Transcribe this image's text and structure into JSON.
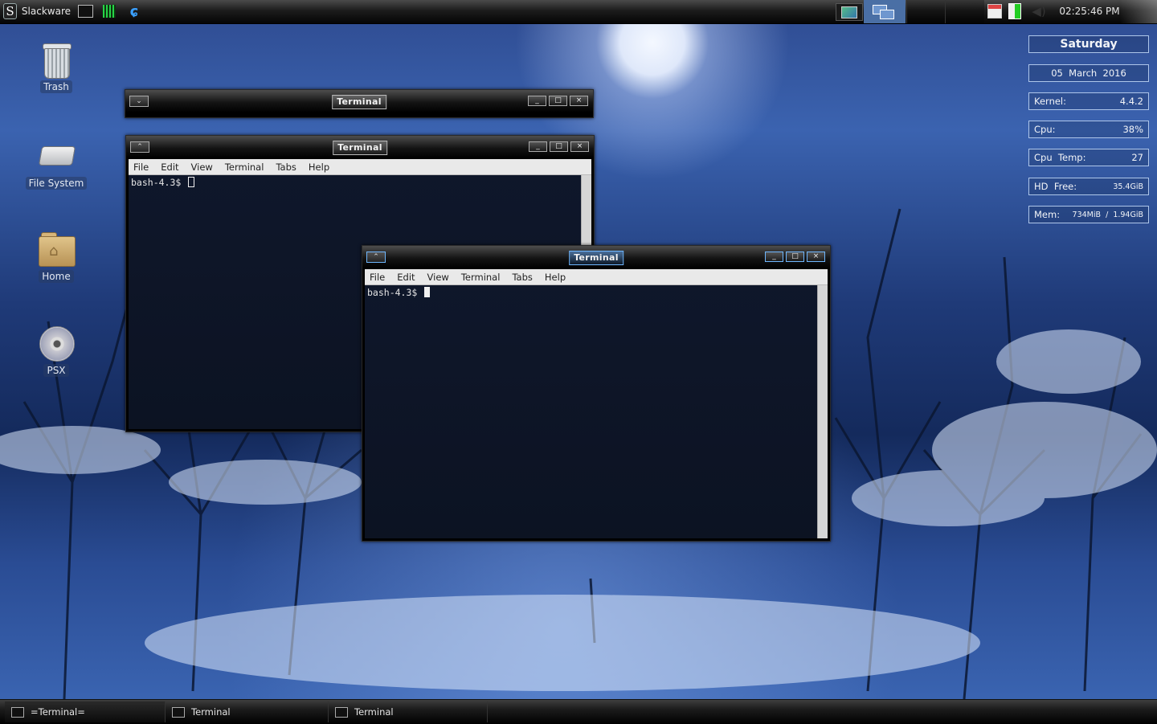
{
  "top_panel": {
    "menu_label": "Slackware",
    "clock": "02:25:46 PM"
  },
  "desktop_icons": {
    "trash": "Trash",
    "file_system": "File System",
    "home": "Home",
    "psx": "PSX"
  },
  "windows": {
    "shaded": {
      "title": "Terminal"
    },
    "back": {
      "title": "Terminal",
      "menu": [
        "File",
        "Edit",
        "View",
        "Terminal",
        "Tabs",
        "Help"
      ],
      "prompt": "bash-4.3$"
    },
    "front": {
      "title": "Terminal",
      "menu": [
        "File",
        "Edit",
        "View",
        "Terminal",
        "Tabs",
        "Help"
      ],
      "prompt": "bash-4.3$"
    }
  },
  "conky": {
    "day": "Saturday",
    "date_day": "05",
    "date_month": "March",
    "date_year": "2016",
    "kernel_label": "Kernel:",
    "kernel_value": "4.4.2",
    "cpu_label": "Cpu:",
    "cpu_value": "38%",
    "cpu_temp_label": "Cpu  Temp:",
    "cpu_temp_value": "27",
    "hd_label": "HD  Free:",
    "hd_value": "35.4GiB",
    "mem_label": "Mem:",
    "mem_used": "734MiB",
    "mem_sep": "/",
    "mem_total": "1.94GiB"
  },
  "taskbar": {
    "tasks": [
      "=Terminal=",
      "Terminal",
      "Terminal"
    ]
  },
  "colors": {
    "panel": "#000000",
    "accent_active_title": "#6fb7ff",
    "conky_border": "#aec6ea"
  },
  "icons": {
    "menu": "slackware-logo",
    "launchers": [
      "terminal-icon",
      "system-monitor-icon",
      "browser-icon"
    ],
    "tray": [
      "network-icon",
      "battery-icon",
      "volume-icon"
    ]
  }
}
